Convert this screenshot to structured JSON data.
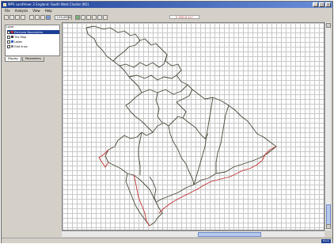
{
  "window": {
    "title": "MPS LandView: 2 England: South West Cluster (N1)",
    "buttons": [
      "_",
      "□",
      "×"
    ]
  },
  "menu": [
    "File",
    "Analysis",
    "View",
    "Help"
  ],
  "toolbar": {
    "scale_value": "1:50,000",
    "coord_readout": "E 359 N 117"
  },
  "layers": {
    "header": "Layer",
    "items": [
      {
        "label": "Electoral Boundaries",
        "checked": true,
        "selected": true,
        "color": "#c03030"
      },
      {
        "label": "The Map",
        "checked": true,
        "selected": false,
        "color": "#404040"
      },
      {
        "label": "Lakes",
        "checked": true,
        "selected": false,
        "color": "#3060c0"
      },
      {
        "label": "Grid lines",
        "checked": true,
        "selected": false,
        "color": "#808080"
      }
    ]
  },
  "tabs": [
    "Display",
    "Parameters"
  ],
  "status": {
    "panel_text": "Done"
  },
  "colors": {
    "boundary_main": "#4a4a3a",
    "boundary_red": "#c03030",
    "title_bar": "#1c3f95"
  }
}
